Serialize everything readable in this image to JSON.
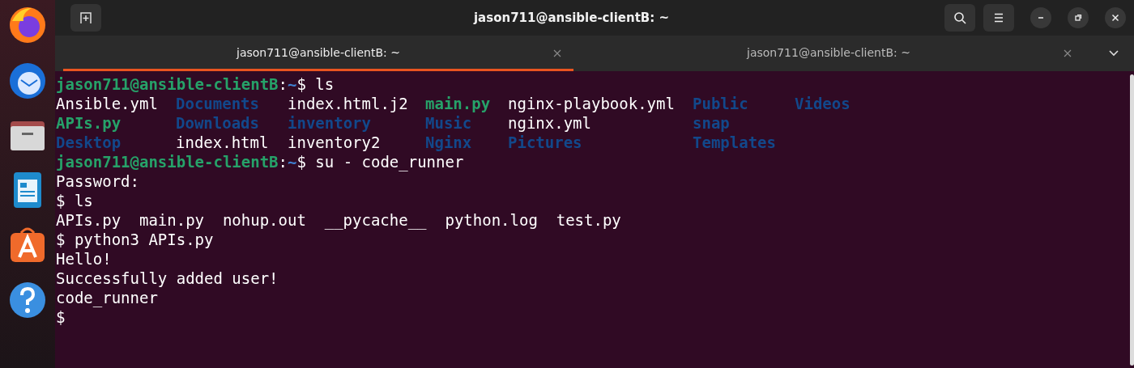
{
  "window": {
    "title": "jason711@ansible-clientB: ~"
  },
  "tabs": [
    {
      "label": "jason711@ansible-clientB: ~",
      "selected": true
    },
    {
      "label": "jason711@ansible-clientB: ~",
      "selected": false
    }
  ],
  "terminal": [
    {
      "kind": "line",
      "segments": [
        {
          "text": "jason711@ansible-clientB",
          "kind": "user"
        },
        {
          "text": ":",
          "kind": "plain"
        },
        {
          "text": "~",
          "kind": "path"
        },
        {
          "text": "$ ls",
          "kind": "plain"
        }
      ]
    },
    {
      "kind": "listing",
      "rows": [
        [
          {
            "text": "Ansible.yml",
            "kind": "plain"
          },
          {
            "text": "Documents",
            "kind": "dir"
          },
          {
            "text": "index.html.j2",
            "kind": "plain"
          },
          {
            "text": "main.py",
            "kind": "exec"
          },
          {
            "text": "nginx-playbook.yml",
            "kind": "plain"
          },
          {
            "text": "Public",
            "kind": "dir"
          },
          {
            "text": "Videos",
            "kind": "dir"
          }
        ],
        [
          {
            "text": "APIs.py",
            "kind": "exec"
          },
          {
            "text": "Downloads",
            "kind": "dir"
          },
          {
            "text": "inventory",
            "kind": "dir"
          },
          {
            "text": "Music",
            "kind": "dir"
          },
          {
            "text": "nginx.yml",
            "kind": "plain"
          },
          {
            "text": "snap",
            "kind": "dir"
          }
        ],
        [
          {
            "text": "Desktop",
            "kind": "dir"
          },
          {
            "text": "index.html",
            "kind": "plain"
          },
          {
            "text": "inventory2",
            "kind": "plain"
          },
          {
            "text": "Nginx",
            "kind": "dir"
          },
          {
            "text": "Pictures",
            "kind": "dir"
          },
          {
            "text": "Templates",
            "kind": "dir"
          }
        ]
      ]
    },
    {
      "kind": "line",
      "segments": [
        {
          "text": "jason711@ansible-clientB",
          "kind": "user"
        },
        {
          "text": ":",
          "kind": "plain"
        },
        {
          "text": "~",
          "kind": "path"
        },
        {
          "text": "$ su - code_runner",
          "kind": "plain"
        }
      ]
    },
    {
      "kind": "line",
      "segments": [
        {
          "text": "Password:",
          "kind": "plain"
        }
      ]
    },
    {
      "kind": "line",
      "segments": [
        {
          "text": "$ ls",
          "kind": "plain"
        }
      ]
    },
    {
      "kind": "line",
      "segments": [
        {
          "text": "APIs.py  main.py  nohup.out  __pycache__  python.log  test.py",
          "kind": "plain"
        }
      ]
    },
    {
      "kind": "line",
      "segments": [
        {
          "text": "$ python3 APIs.py",
          "kind": "plain"
        }
      ]
    },
    {
      "kind": "line",
      "segments": [
        {
          "text": "Hello!",
          "kind": "plain"
        }
      ]
    },
    {
      "kind": "line",
      "segments": [
        {
          "text": "Successfully added user!",
          "kind": "plain"
        }
      ]
    },
    {
      "kind": "line",
      "segments": [
        {
          "text": "code_runner",
          "kind": "plain"
        }
      ]
    },
    {
      "kind": "line",
      "segments": [
        {
          "text": "$",
          "kind": "plain"
        }
      ]
    }
  ]
}
